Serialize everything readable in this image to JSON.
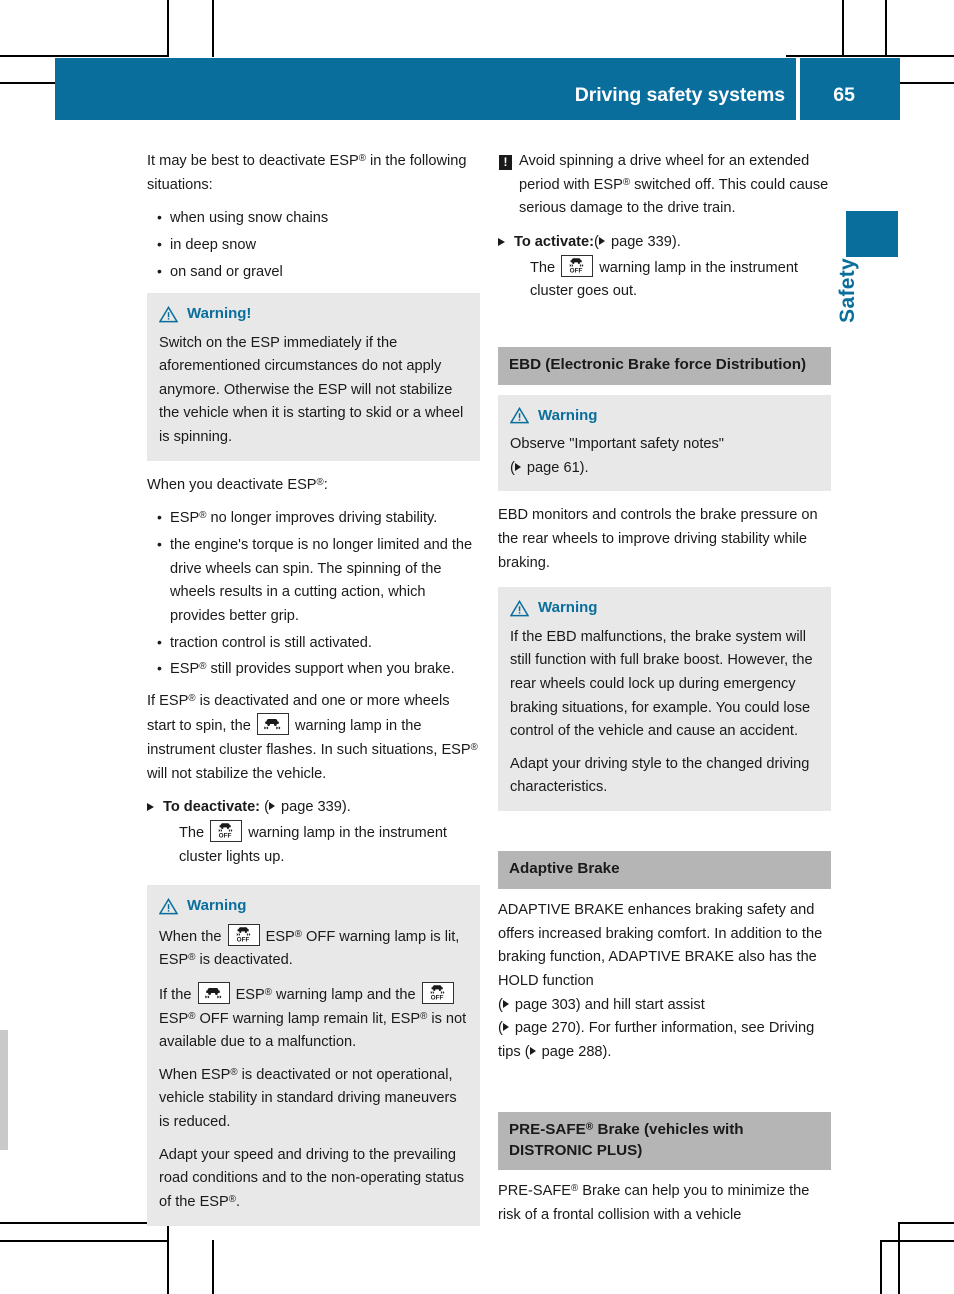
{
  "header": {
    "title": "Driving safety systems",
    "page_number": "65",
    "accent_color": "#0a6e9d"
  },
  "thumb_tab": {
    "label": "Safety"
  },
  "icons": {
    "warning_triangle": "warning-triangle-icon",
    "exclamation_square": "exclamation-square-icon",
    "esp_lamp": "esp-warning-lamp-icon",
    "esp_off_lamp": "esp-off-warning-lamp-icon",
    "esp_off_text": "OFF"
  },
  "left_column": {
    "intro": "It may be best to deactivate ESP® in the following situations:",
    "intro_pre": "It may be best to deactivate ESP",
    "intro_post": " in the following situations:",
    "bullets": [
      "when using snow chains",
      "in deep snow",
      "on sand or gravel"
    ],
    "warning_1": {
      "title": "Warning!",
      "body": "Switch on the ESP immediately if the aforementioned circumstances do not apply anymore. Otherwise the ESP will not stabilize the vehicle when it is starting to skid or a wheel is spinning."
    },
    "deactivate_intro_pre": "When you deactivate ESP",
    "deactivate_intro_post": ":",
    "deactivate_bullets": [
      {
        "pre": "ESP",
        "post": " no longer improves driving stability."
      },
      {
        "pre": "",
        "post": "the engine's torque is no longer limited and the drive wheels can spin. The spinning of the wheels results in a cutting action, which provides better grip."
      },
      {
        "pre": "",
        "post": "traction control is still activated."
      },
      {
        "pre": "ESP",
        "post": " still provides support when you brake."
      }
    ],
    "flash_text_a": "If ESP",
    "flash_text_b": " is deactivated and one or more wheels start to spin, the ",
    "flash_text_c": " warning lamp in the instrument cluster flashes. In such situations, ESP",
    "flash_text_d": " will not stabilize the vehicle.",
    "step_deactivate_label": "To deactivate:",
    "step_deactivate_ref": " page 339).",
    "step_deactivate_line_a": "The ",
    "step_deactivate_line_b": " warning lamp in the instrument cluster lights up.",
    "warning_2": {
      "title": "Warning",
      "p1_a": "When the ",
      "p1_b": " ESP",
      "p1_c": " OFF warning lamp is lit, ESP",
      "p1_d": " is deactivated.",
      "p2_a": "If the ",
      "p2_b": " ESP",
      "p2_c": " warning lamp and the ",
      "p2_d": " ESP",
      "p2_e": " OFF warning lamp remain lit, ESP",
      "p2_f": " is not available due to a malfunction.",
      "p3_a": "When ESP",
      "p3_b": " is deactivated or not operational, vehicle stability in standard driving maneuvers is reduced.",
      "p4_a": "Adapt your speed and driving to the prevailing road conditions and to the non-operating status of the ESP",
      "p4_b": "."
    }
  },
  "right_column": {
    "note_1_a": "Avoid spinning a drive wheel for an extended period with ESP",
    "note_1_b": " switched off. This could cause serious damage to the drive train.",
    "step_activate_label": "To activate:",
    "step_activate_ref": " page 339).",
    "step_activate_line_a": "The ",
    "step_activate_line_b": " warning lamp in the instrument cluster goes out.",
    "ebd_heading": "EBD (Electronic Brake force Distribution)",
    "warning_ebd_1": {
      "title": "Warning",
      "line1": "Observe \"Important safety notes\"",
      "line2_ref": " page 61)."
    },
    "ebd_body": "EBD monitors and controls the brake pressure on the rear wheels to improve driving stability while braking.",
    "warning_ebd_2": {
      "title": "Warning",
      "p1": "If the EBD malfunctions, the brake system will still function with full brake boost. However, the rear wheels could lock up during emergency braking situations, for example. You could lose control of the vehicle and cause an accident.",
      "p2": "Adapt your driving style to the changed driving characteristics."
    },
    "adaptive_heading": "Adaptive Brake",
    "adaptive_body_a": "ADAPTIVE BRAKE enhances braking safety and offers increased braking comfort. In addition to the braking function, ADAPTIVE BRAKE also has the HOLD function",
    "adaptive_ref_1": " page 303) and hill start assist",
    "adaptive_ref_2": " page 270). For further information, see Driving tips (",
    "adaptive_ref_3": " page 288).",
    "presafe_heading_a": "PRE-SAFE",
    "presafe_heading_b": " Brake (vehicles with DISTRONIC PLUS)",
    "presafe_body_a": "PRE-SAFE",
    "presafe_body_b": " Brake can help you to minimize the risk of a frontal collision with a vehicle"
  }
}
